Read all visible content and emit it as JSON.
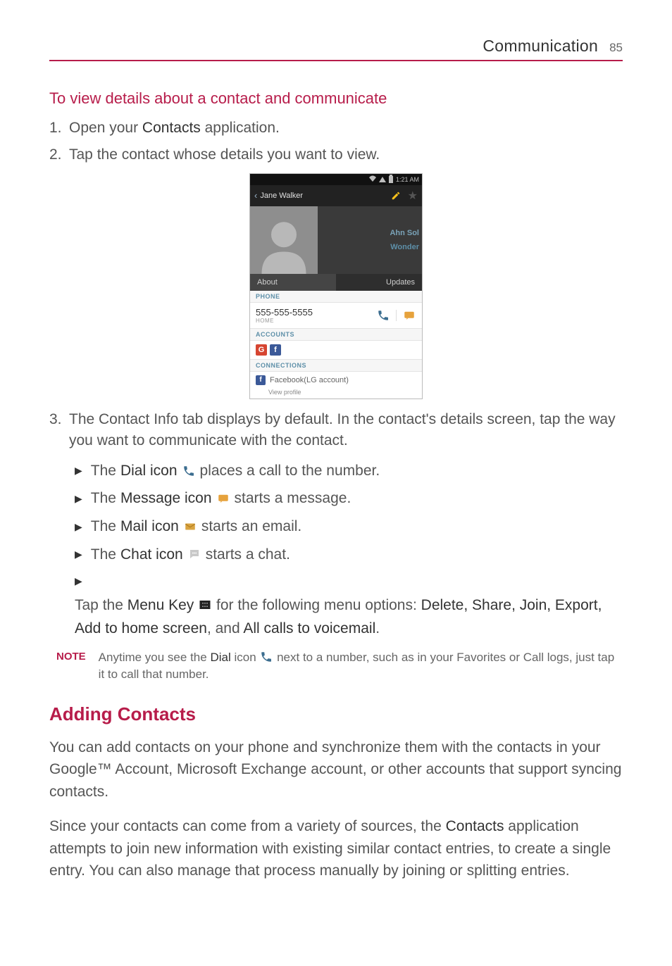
{
  "header": {
    "section": "Communication",
    "page": "85"
  },
  "sec1_heading": "To view details about a contact and communicate",
  "steps": {
    "s1": {
      "num": "1.",
      "a": "Open your ",
      "b": "Contacts",
      "c": " application."
    },
    "s2": {
      "num": "2.",
      "a": "Tap the contact whose details you want to view."
    },
    "s3": {
      "num": "3.",
      "a": "The Contact Info tab displays by default. In the contact's details screen, tap the way you want to communicate with the contact."
    }
  },
  "shot": {
    "time": "1:21 AM",
    "name": "Jane Walker",
    "side1": "Ahn Sol",
    "side2": "Wonder",
    "tab_about": "About",
    "tab_updates": "Updates",
    "lbl_phone": "PHONE",
    "phone_number": "555-555-5555",
    "phone_type": "HOME",
    "lbl_accounts": "ACCOUNTS",
    "lbl_connections": "CONNECTIONS",
    "fb_account": "Facebook(LG account)",
    "more": "View profile"
  },
  "bullets": {
    "b1": {
      "a": "The ",
      "b": "Dial icon",
      "c": " places a call to the number."
    },
    "b2": {
      "a": "The ",
      "b": "Message icon",
      "c": " starts a message."
    },
    "b3": {
      "a": "The ",
      "b": "Mail icon",
      "c": " starts an email."
    },
    "b4": {
      "a": "The ",
      "b": "Chat icon",
      "c": " starts a chat."
    },
    "b5": {
      "a": "Tap the ",
      "b": "Menu Key",
      "c": " for the following menu options: ",
      "d": "Delete, Share, Join, Export, Add to home screen",
      "e": ", and ",
      "f": "All calls to voicemail",
      "g": "."
    }
  },
  "note": {
    "label": "NOTE",
    "a": "Anytime you see the ",
    "b": "Dial",
    "c": " icon ",
    "d": " next to a number, such as in your Favorites or Call logs, just tap it to call that number."
  },
  "h2": "Adding Contacts",
  "p1": "You can add contacts on your phone and synchronize them with the contacts in your Google™ Account, Microsoft Exchange account, or other accounts that support syncing contacts.",
  "p2a": "Since your contacts can come from a variety of sources, the ",
  "p2b": "Contacts",
  "p2c": " application attempts to join new information with existing similar contact entries, to create a single entry. You can also manage that process manually by joining or splitting entries."
}
